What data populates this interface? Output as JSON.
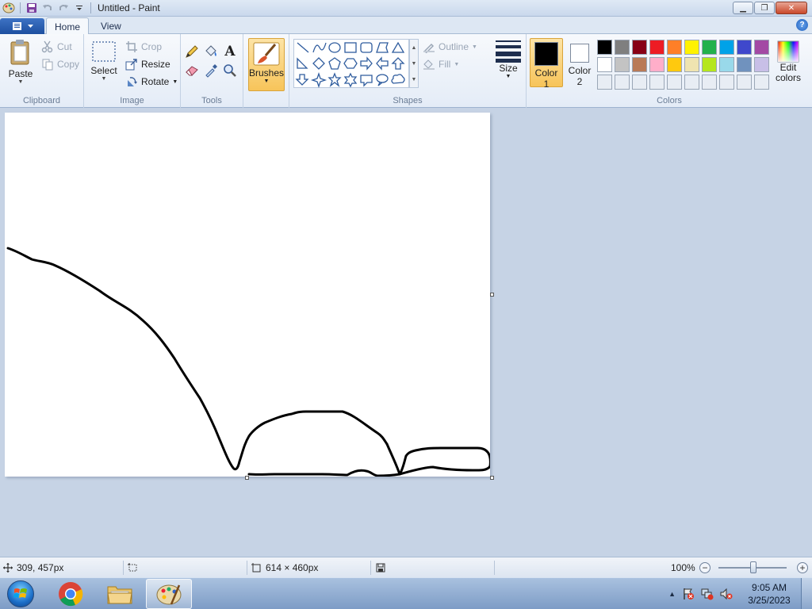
{
  "window": {
    "title": "Untitled - Paint",
    "minimize_glyph": "▁",
    "restore_glyph": "❐",
    "close_glyph": "✕"
  },
  "tabs": [
    {
      "label": "Home",
      "active": true
    },
    {
      "label": "View",
      "active": false
    }
  ],
  "help_glyph": "?",
  "ribbon": {
    "clipboard": {
      "group_label": "Clipboard",
      "paste": "Paste",
      "cut": "Cut",
      "copy": "Copy"
    },
    "image": {
      "group_label": "Image",
      "select": "Select",
      "crop": "Crop",
      "resize": "Resize",
      "rotate": "Rotate"
    },
    "tools": {
      "group_label": "Tools",
      "text_tool": "A"
    },
    "brushes": {
      "label": "Brushes"
    },
    "shapes": {
      "group_label": "Shapes",
      "outline": "Outline",
      "fill": "Fill"
    },
    "size": {
      "label": "Size"
    },
    "colors": {
      "group_label": "Colors",
      "color1_label": "Color",
      "color1_num": "1",
      "color2_label": "Color",
      "color2_num": "2",
      "edit_label": "Edit",
      "edit_label2": "colors",
      "color1": "#000000",
      "color2": "#ffffff",
      "palette": [
        "#000000",
        "#7f7f7f",
        "#880015",
        "#ed1c24",
        "#ff7f27",
        "#fff200",
        "#22b14c",
        "#00a2e8",
        "#3f48cc",
        "#a349a4",
        "#ffffff",
        "#c3c3c3",
        "#b97a57",
        "#ffaec9",
        "#ffc90e",
        "#efe4b0",
        "#b5e61d",
        "#99d9ea",
        "#7092be",
        "#c8bfe7",
        "#e8edf4",
        "#e8edf4",
        "#e8edf4",
        "#e8edf4",
        "#e8edf4",
        "#e8edf4",
        "#e8edf4",
        "#e8edf4",
        "#e8edf4",
        "#e8edf4"
      ]
    }
  },
  "canvas": {
    "background": "#ffffff",
    "stroke_color": "#000000"
  },
  "status": {
    "cursor_pos": "309, 457px",
    "canvas_size": "614 × 460px",
    "zoom": "100%",
    "zoom_out": "−",
    "zoom_in": "+"
  },
  "taskbar": {
    "time": "9:05 AM",
    "date": "3/25/2023",
    "tray_arrow": "▲"
  }
}
